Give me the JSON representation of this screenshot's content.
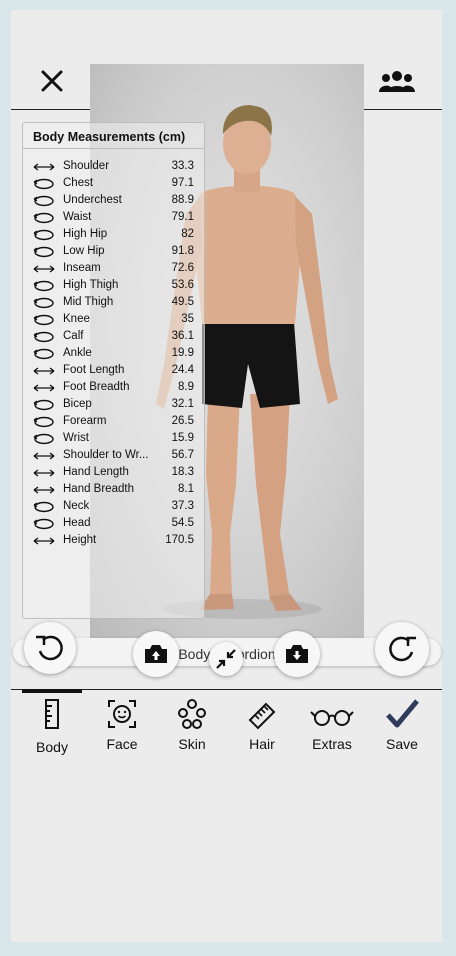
{
  "panel": {
    "title": "Body Measurements (cm)",
    "rows": [
      {
        "label": "Shoulder",
        "value": "33.3",
        "icon": "length-arrow-icon"
      },
      {
        "label": "Chest",
        "value": "97.1",
        "icon": "circumference-icon"
      },
      {
        "label": "Underchest",
        "value": "88.9",
        "icon": "circumference-icon"
      },
      {
        "label": "Waist",
        "value": "79.1",
        "icon": "circumference-icon"
      },
      {
        "label": "High Hip",
        "value": "82",
        "icon": "circumference-icon"
      },
      {
        "label": "Low Hip",
        "value": "91.8",
        "icon": "circumference-icon"
      },
      {
        "label": "Inseam",
        "value": "72.6",
        "icon": "length-arrow-icon"
      },
      {
        "label": "High Thigh",
        "value": "53.6",
        "icon": "circumference-icon"
      },
      {
        "label": "Mid Thigh",
        "value": "49.5",
        "icon": "circumference-icon"
      },
      {
        "label": "Knee",
        "value": "35",
        "icon": "circumference-icon"
      },
      {
        "label": "Calf",
        "value": "36.1",
        "icon": "circumference-icon"
      },
      {
        "label": "Ankle",
        "value": "19.9",
        "icon": "circumference-icon"
      },
      {
        "label": "Foot Length",
        "value": "24.4",
        "icon": "length-arrow-icon"
      },
      {
        "label": "Foot Breadth",
        "value": "8.9",
        "icon": "length-arrow-icon"
      },
      {
        "label": "Bicep",
        "value": "32.1",
        "icon": "circumference-icon"
      },
      {
        "label": "Forearm",
        "value": "26.5",
        "icon": "circumference-icon"
      },
      {
        "label": "Wrist",
        "value": "15.9",
        "icon": "circumference-icon"
      },
      {
        "label": "Shoulder to Wr...",
        "value": "56.7",
        "icon": "length-arrow-icon"
      },
      {
        "label": "Hand Length",
        "value": "18.3",
        "icon": "length-arrow-icon"
      },
      {
        "label": "Hand Breadth",
        "value": "8.1",
        "icon": "length-arrow-icon"
      },
      {
        "label": "Neck",
        "value": "37.3",
        "icon": "circumference-icon"
      },
      {
        "label": "Head",
        "value": "54.5",
        "icon": "circumference-icon"
      },
      {
        "label": "Height",
        "value": "170.5",
        "icon": "length-arrow-icon"
      }
    ]
  },
  "controls": {
    "title": "Body Accordion"
  },
  "tabs": [
    {
      "label": "Body",
      "icon": "ruler-icon"
    },
    {
      "label": "Face",
      "icon": "face-icon"
    },
    {
      "label": "Skin",
      "icon": "skin-dots-icon"
    },
    {
      "label": "Hair",
      "icon": "comb-icon"
    },
    {
      "label": "Extras",
      "icon": "glasses-icon"
    },
    {
      "label": "Save",
      "icon": "checkmark-icon"
    }
  ],
  "colors": {
    "background": "#d9e6ea",
    "app": "#ececec",
    "save_check": "#2f3a5c"
  }
}
